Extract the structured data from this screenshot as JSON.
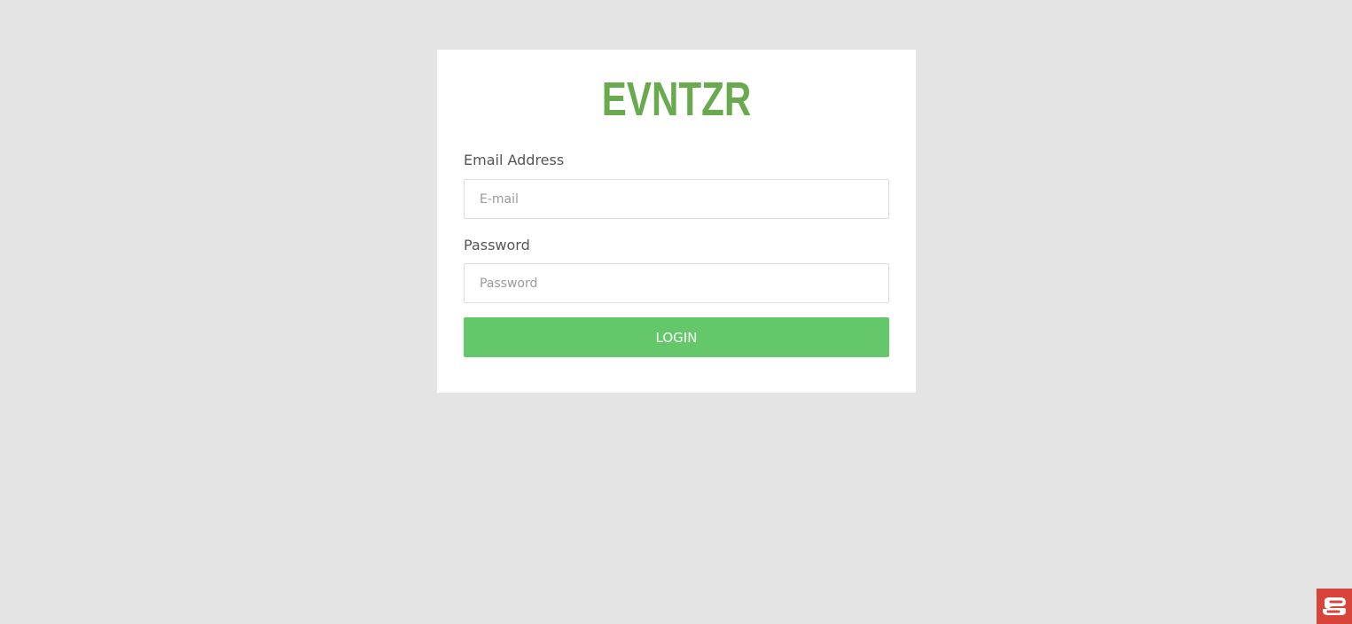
{
  "brand": {
    "logo_text": "EVNTZR",
    "logo_color": "#6aaa4e"
  },
  "login_form": {
    "email_label": "Email Address",
    "email_placeholder": "E-mail",
    "email_value": "",
    "password_label": "Password",
    "password_placeholder": "Password",
    "password_value": "",
    "submit_label": "LOGIN",
    "submit_color": "#64c769"
  },
  "support_widget": {
    "icon": "chat-support-icon",
    "color": "#d8433a"
  },
  "colors": {
    "page_background": "#e4e4e4",
    "card_background": "#ffffff"
  }
}
